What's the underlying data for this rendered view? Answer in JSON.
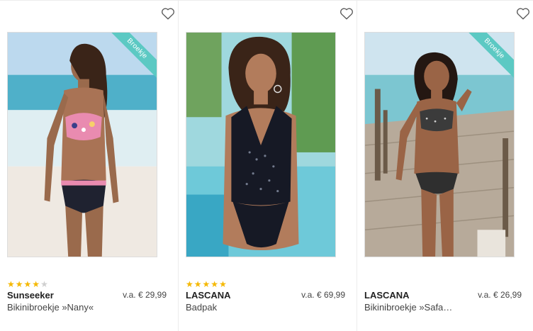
{
  "products": [
    {
      "ribbon": "Broekje",
      "rating": 4,
      "rating_max": 5,
      "brand": "Sunseeker",
      "price": "v.a. € 29,99",
      "title": "Bikinibroekje »Nany«",
      "image_icon": "model-photo-bikini-floral"
    },
    {
      "ribbon": "",
      "rating": 5,
      "rating_max": 5,
      "brand": "LASCANA",
      "price": "v.a. € 69,99",
      "title": "Badpak",
      "image_icon": "model-photo-swimsuit-black"
    },
    {
      "ribbon": "Broekje",
      "rating": 0,
      "rating_max": 5,
      "brand": "LASCANA",
      "price": "v.a. € 26,99",
      "title": "Bikinibroekje »Safa…",
      "image_icon": "model-photo-bikini-animal-print"
    }
  ],
  "colors": {
    "ribbon": "#5cc9c3",
    "star_on": "#f5b800",
    "star_off": "#cfcfcf"
  }
}
